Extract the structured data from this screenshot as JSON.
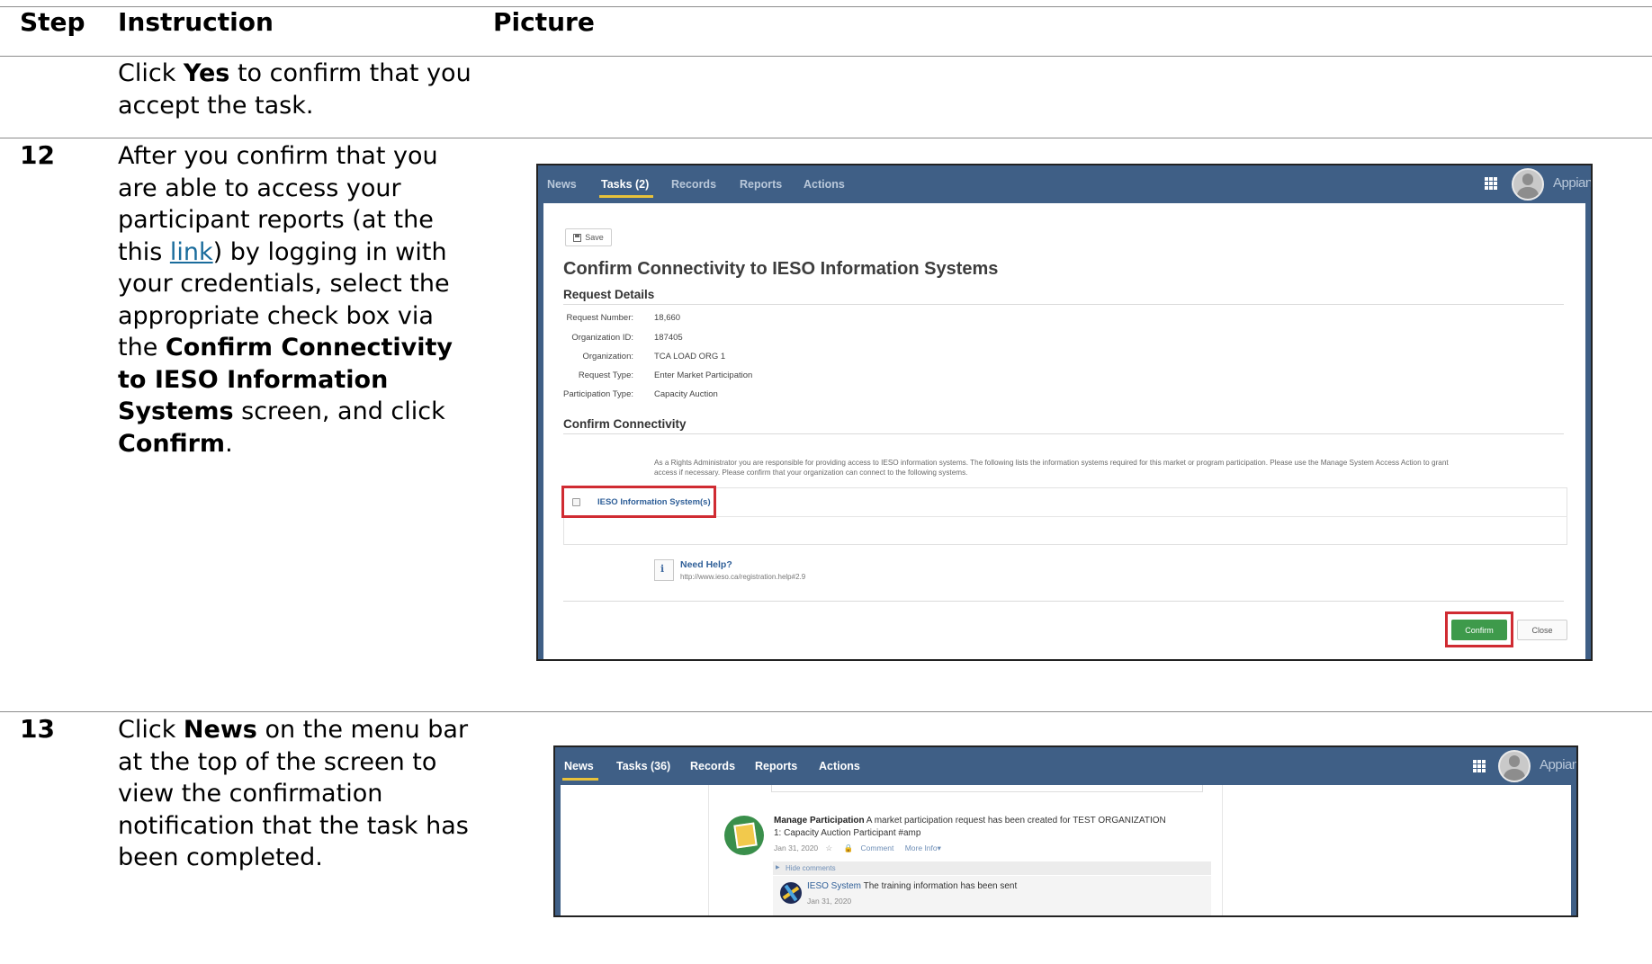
{
  "table": {
    "headers": {
      "step": "Step",
      "instruction": "Instruction",
      "picture": "Picture"
    }
  },
  "rows": [
    {
      "step": "",
      "instruction": {
        "t1": "Click ",
        "b1": "Yes",
        "t2": " to confirm that you accept the task."
      }
    },
    {
      "step": "12",
      "instruction": {
        "t1": "After you confirm that you are able to access your participant reports (at the this ",
        "link": "link",
        "t2": ") by logging in with your credentials, select the appropriate check box via the ",
        "b1": "Confirm Connectivity to IESO Information Systems",
        "t3": " screen, and click ",
        "b2": "Confirm",
        "t4": "."
      }
    },
    {
      "step": "13",
      "instruction": {
        "t1": "Click ",
        "b1": "News",
        "t2": " on the menu bar at the top of the screen to view the confirmation notification that the task has been completed."
      }
    }
  ],
  "screenshot1": {
    "nav": {
      "news": "News",
      "tasks": "Tasks (2)",
      "records": "Records",
      "reports": "Reports",
      "actions": "Actions",
      "brand": "Appian"
    },
    "save_label": "Save",
    "title": "Confirm Connectivity to IESO Information Systems",
    "request_details_header": "Request Details",
    "fields": [
      {
        "label": "Request Number:",
        "value": "18,660"
      },
      {
        "label": "Organization ID:",
        "value": "187405"
      },
      {
        "label": "Organization:",
        "value": "TCA LOAD ORG 1"
      },
      {
        "label": "Request Type:",
        "value": "Enter Market Participation"
      },
      {
        "label": "Participation Type:",
        "value": "Capacity Auction"
      }
    ],
    "confirm_header": "Confirm Connectivity",
    "description_line1": "As a Rights Administrator you are responsible for providing access to IESO information systems. The following lists the information systems required for this market or program participation. Please use the Manage System Access Action to grant",
    "description_line2": "access if necessary. Please confirm that your organization can connect to the following systems.",
    "checkbox_label": "IESO Information System(s)",
    "help_title": "Need Help?",
    "help_url": "http://www.ieso.ca/registration.help#2.9",
    "confirm_button": "Confirm",
    "close_button": "Close",
    "colors": {
      "nav_bg": "#3f5f86",
      "active_underline": "#e8c23a",
      "confirm_green": "#3e9a4b",
      "highlight_red": "#d02b32"
    }
  },
  "screenshot2": {
    "nav": {
      "news": "News",
      "tasks": "Tasks (36)",
      "records": "Records",
      "reports": "Reports",
      "actions": "Actions",
      "brand": "Appian"
    },
    "post_author": "Manage Participation",
    "post_text_1": " A market participation request has been created for TEST ORGANIZATION",
    "post_text_2": "1: Capacity Auction Participant #amp",
    "post_date": "Jan 31, 2020",
    "post_comment": "Comment",
    "post_more": "More Info",
    "hide_comments": "Hide comments",
    "comment_author": "IESO System",
    "comment_text": " The training information has been sent",
    "comment_date": "Jan 31, 2020"
  }
}
